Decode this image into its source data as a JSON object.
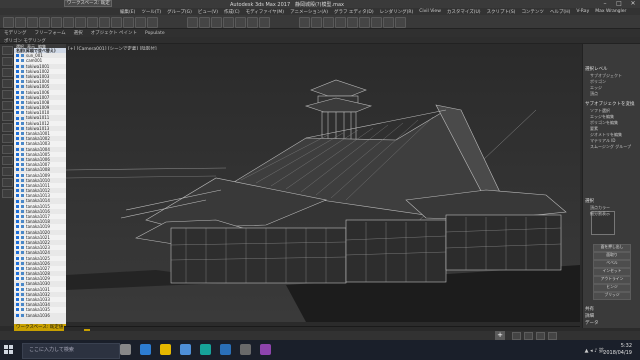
{
  "title": {
    "workspace": "ワークスペース: 既定",
    "app": "Autodesk 3ds Max 2017",
    "file": "静岡城殿(?)模型.max"
  },
  "menu": [
    "編集(E)",
    "ツール(T)",
    "グループ(G)",
    "ビュー(V)",
    "作成(C)",
    "モディファイヤ(M)",
    "アニメーション(A)",
    "グラフ エディタ(D)",
    "レンダリング(R)",
    "Civil View",
    "カスタマイズ(U)",
    "スクリプト(S)",
    "コンテンツ",
    "ヘルプ(H)",
    "V-Ray",
    "Max Wrangler"
  ],
  "ribbon": [
    "モデリング",
    "フリーフォーム",
    "選択",
    "オブジェクト ペイント",
    "Populate"
  ],
  "subbar": {
    "left": "ポリゴン モデリング",
    "tabs": [
      "選択",
      "表示",
      "編集"
    ]
  },
  "scene": {
    "header": "名前(昇順で並べ替え)",
    "rows": [
      "sun_001",
      "cam001",
      "tokiwa1001",
      "tokiwa1002",
      "tokiwa1003",
      "tokiwa1004",
      "tokiwa1005",
      "tokiwa1006",
      "tokiwa1007",
      "tokiwa1008",
      "tokiwa1009",
      "tokiwa1010",
      "tokiwa1011",
      "tokiwa1012",
      "tokiwa1013",
      "tanaka1001",
      "tanaka1002",
      "tanaka1003",
      "tanaka1004",
      "tanaka1005",
      "tanaka1006",
      "tanaka1007",
      "tanaka1008",
      "tanaka1009",
      "tanaka1010",
      "tanaka1011",
      "tanaka1012",
      "tanaka1013",
      "tanaka1014",
      "tanaka1015",
      "tanaka1016",
      "tanaka1017",
      "tanaka1018",
      "tanaka1019",
      "tanaka1020",
      "tanaka1021",
      "tanaka1022",
      "tanaka1023",
      "tanaka1024",
      "tanaka1025",
      "tanaka1026",
      "tanaka1027",
      "tanaka1028",
      "tanaka1029",
      "tanaka1030",
      "tanaka1031",
      "tanaka1032",
      "tanaka1033",
      "tanaka1034",
      "tanaka1035",
      "tanaka1036"
    ],
    "footer": "ワークスペース: 既定値"
  },
  "viewport_label": "[+] [Camera001] [シーンで定義] [陰影付]",
  "right_panel": {
    "sections": [
      {
        "head": "選択レベル",
        "items": [
          "サブオブジェクト",
          "ポリゴン",
          "エッジ",
          "頂点"
        ]
      },
      {
        "head": "サブオブジェクトを変換",
        "items": [
          "ソフト選択",
          "エッジを編集",
          "ポリゴンを編集",
          "要素",
          "ジオメトリを編集",
          "マテリアル ID",
          "スムージング グループ"
        ]
      },
      {
        "head": "選択",
        "items": [
          "頂点カラー",
          "細分割表示"
        ]
      }
    ],
    "buttons": [
      "面を押し出し",
      "面取り",
      "ベベル",
      "インセット",
      "アウトライン",
      "ヒンジ",
      "ブリッジ"
    ],
    "more": [
      "共有",
      "詳細",
      "データ"
    ]
  },
  "timeline": {
    "frame": "0 / 100"
  },
  "taskbar": {
    "search": "ここに入力して検索",
    "time": "5:32",
    "date": "2018/04/19",
    "apps": [
      {
        "icon": "task-view-icon",
        "color": "#888"
      },
      {
        "icon": "edge-icon",
        "color": "#2d7dd2"
      },
      {
        "icon": "folder-icon",
        "color": "#e6b800"
      },
      {
        "icon": "store-icon",
        "color": "#4e8fd8"
      },
      {
        "icon": "3dsmax-icon",
        "color": "#16a39a"
      },
      {
        "icon": "photoshop-icon",
        "color": "#2a6fb8"
      },
      {
        "icon": "app-icon",
        "color": "#6a6a6a"
      },
      {
        "icon": "vray-icon",
        "color": "#8e44ad"
      }
    ]
  }
}
